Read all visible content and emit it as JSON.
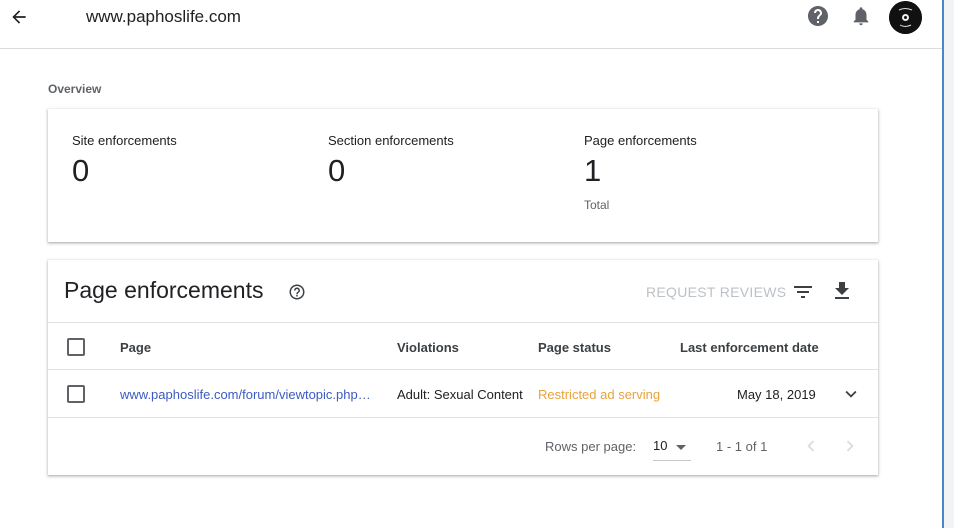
{
  "header": {
    "site_title": "www.paphoslife.com",
    "back_icon": "arrow-back-icon",
    "help_icon": "help-circle-icon",
    "notifications_icon": "bell-icon",
    "avatar_icon": "user-avatar"
  },
  "overview": {
    "label": "Overview",
    "stats": [
      {
        "label": "Site enforcements",
        "value": "0"
      },
      {
        "label": "Section enforcements",
        "value": "0"
      },
      {
        "label": "Page enforcements",
        "value": "1",
        "sub": "Total"
      }
    ]
  },
  "page_enforcements": {
    "title": "Page enforcements",
    "request_reviews_label": "REQUEST REVIEWS",
    "columns": {
      "page": "Page",
      "violations": "Violations",
      "status": "Page status",
      "date": "Last enforcement date"
    },
    "rows": [
      {
        "page": "www.paphoslife.com/forum/viewtopic.php…",
        "violations": "Adult: Sexual Content",
        "status": "Restricted ad serving",
        "date": "May 18, 2019"
      }
    ],
    "footer": {
      "rows_per_page_label": "Rows per page:",
      "rows_per_page_value": "10",
      "range": "1 - 1 of 1"
    }
  },
  "colors": {
    "link": "#3c5bbf",
    "status_warning": "#e8a33d",
    "disabled_text": "#bdc1c6"
  }
}
